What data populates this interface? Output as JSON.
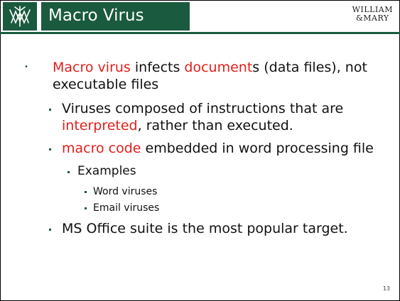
{
  "header": {
    "title": "Macro Virus",
    "logo_line1": "WILLIAM",
    "logo_line2": "&MARY"
  },
  "bullets": {
    "b1": {
      "seg1": "Macro virus",
      "seg2": " infects ",
      "seg3": "document",
      "seg4": "s (data files), not",
      "line2": "executable files"
    },
    "b2": {
      "line1": "Viruses composed of instructions that are",
      "seg1": "interpreted",
      "seg2": ", rather than executed."
    },
    "b3": {
      "seg1": "macro code",
      "seg2": " embedded in word processing file"
    },
    "b4": {
      "text": "Examples"
    },
    "b5": {
      "text": "Word viruses"
    },
    "b6": {
      "text": "Email viruses"
    },
    "b7": {
      "text": "MS Office suite is the most popular target."
    }
  },
  "footer": {
    "page_number": "13"
  },
  "colors": {
    "brand_green": "#1a5a3e",
    "highlight_red": "#e0201b"
  }
}
